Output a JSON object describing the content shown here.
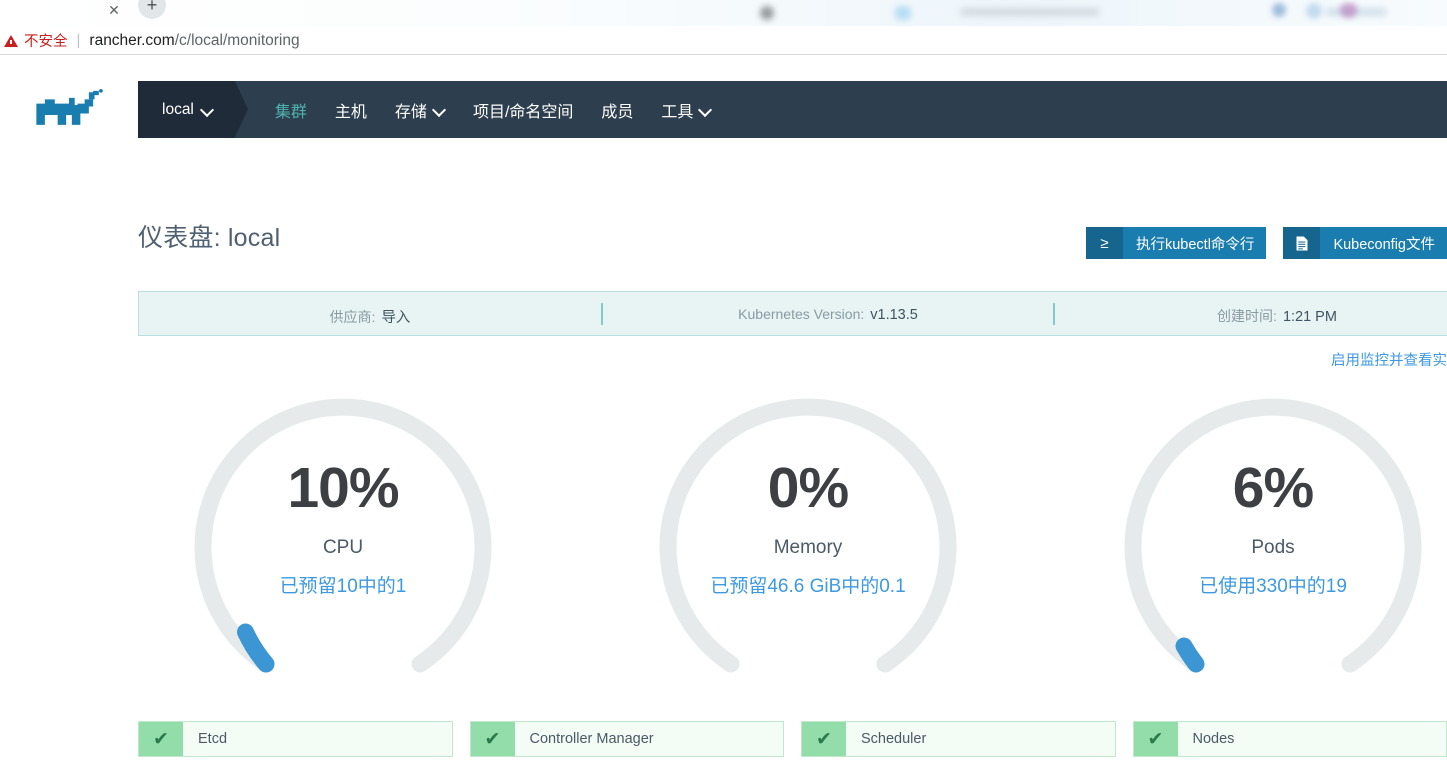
{
  "browser": {
    "security_label": "不安全",
    "url_host": "rancher.com",
    "url_path": "/c/local/monitoring",
    "separator": "|",
    "close_tab_glyph": "✕",
    "new_tab_glyph": "+"
  },
  "topnav": {
    "logo_name": "rancher-cow-logo",
    "cluster_name": "local",
    "links": [
      {
        "label": "集群",
        "active": true,
        "dropdown": false
      },
      {
        "label": "主机",
        "active": false,
        "dropdown": false
      },
      {
        "label": "存储",
        "active": false,
        "dropdown": true
      },
      {
        "label": "项目/命名空间",
        "active": false,
        "dropdown": false
      },
      {
        "label": "成员",
        "active": false,
        "dropdown": false
      },
      {
        "label": "工具",
        "active": false,
        "dropdown": true
      }
    ]
  },
  "header": {
    "title_prefix": "仪表盘: ",
    "title_value": "local",
    "buttons": [
      {
        "label": "执行kubectl命令行",
        "icon": "≥",
        "icon_name": "terminal-prompt-icon"
      },
      {
        "label": "Kubeconfig文件",
        "icon": "▤",
        "icon_name": "document-icon"
      }
    ]
  },
  "infobar": {
    "items": [
      {
        "label": "供应商:",
        "value": "导入"
      },
      {
        "label": "Kubernetes Version:",
        "value": "v1.13.5"
      },
      {
        "label": "创建时间:",
        "value": "1:21 PM"
      }
    ]
  },
  "monitoring_link": "启用监控并查看实",
  "gauges": [
    {
      "percent_text": "10%",
      "percent_value": 10,
      "name": "CPU",
      "subtitle": "已预留10中的1",
      "used": 1,
      "total": 10,
      "unit": "",
      "arc_color": "#3d96d4",
      "track_color": "#e6eaeb"
    },
    {
      "percent_text": "0%",
      "percent_value": 0,
      "name": "Memory",
      "subtitle": "已预留46.6 GiB中的0.1",
      "used": 0.1,
      "total": 46.6,
      "unit": "GiB",
      "arc_color": "#3d96d4",
      "track_color": "#e6eaeb"
    },
    {
      "percent_text": "6%",
      "percent_value": 6,
      "name": "Pods",
      "subtitle": "已使用330中的19",
      "used": 19,
      "total": 330,
      "unit": "",
      "arc_color": "#3d96d4",
      "track_color": "#e6eaeb"
    }
  ],
  "status_cards": [
    {
      "label": "Etcd",
      "state": "healthy",
      "icon": "✔"
    },
    {
      "label": "Controller Manager",
      "state": "healthy",
      "icon": "✔"
    },
    {
      "label": "Scheduler",
      "state": "healthy",
      "icon": "✔"
    },
    {
      "label": "Nodes",
      "state": "healthy",
      "icon": "✔"
    }
  ],
  "colors": {
    "nav_bg": "#2d3e4e",
    "cluster_bg": "#1f2b38",
    "accent_teal": "#4fb2ac",
    "brand_blue": "#1a7db0",
    "link_blue": "#3d9ae0",
    "info_bg": "#e8f4f4",
    "status_green": "#93ddaa"
  }
}
